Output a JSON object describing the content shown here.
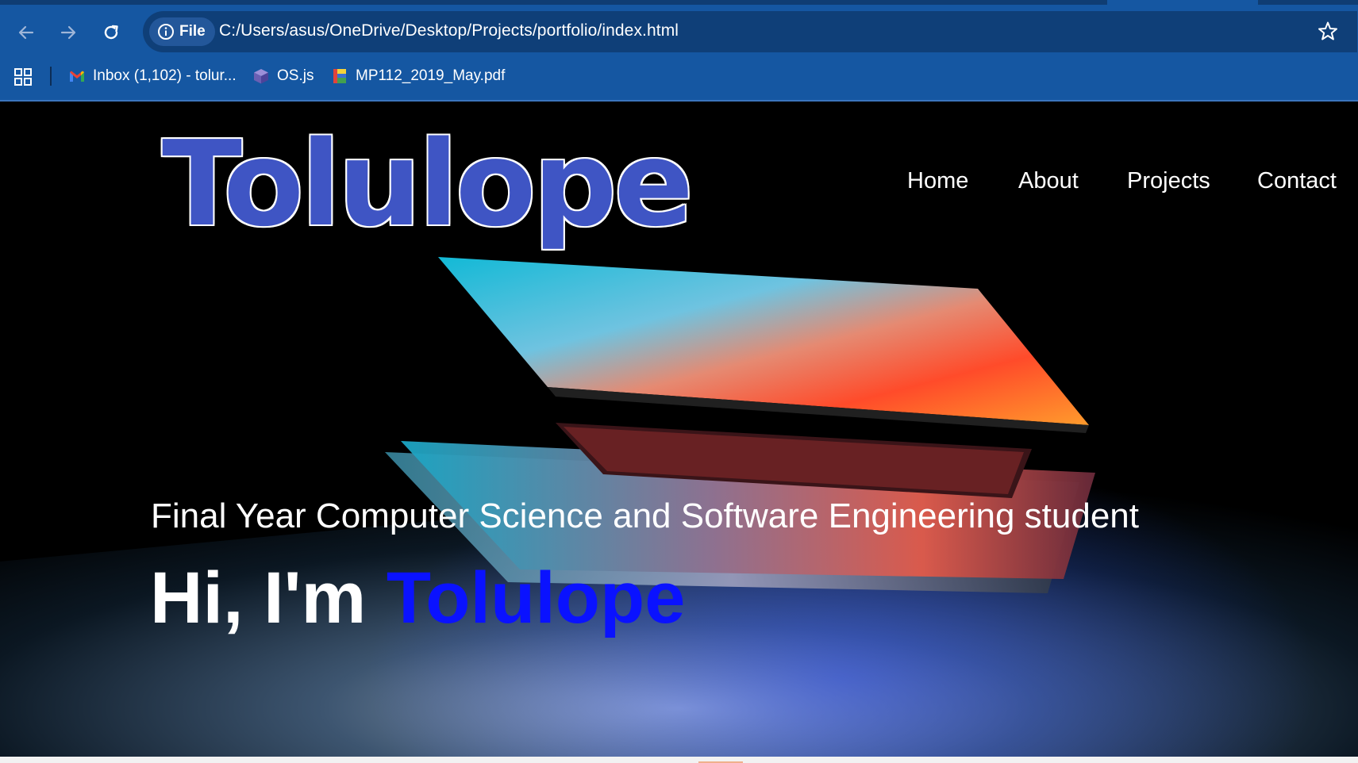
{
  "browser": {
    "site_chip_label": "File",
    "url": "C:/Users/asus/OneDrive/Desktop/Projects/portfolio/index.html",
    "bookmarks": [
      {
        "label": "Inbox (1,102) - tolur...",
        "icon": "gmail-icon"
      },
      {
        "label": "OS.js",
        "icon": "cube-icon"
      },
      {
        "label": "MP112_2019_May.pdf",
        "icon": "pdf-file-icon"
      }
    ],
    "icons": {
      "back": "back-arrow-icon",
      "forward": "forward-arrow-icon",
      "reload": "reload-icon",
      "info": "info-icon",
      "star": "star-icon",
      "apps": "apps-grid-icon"
    },
    "colors": {
      "toolbar": "#1557a2",
      "omnibox": "#0f3f78"
    }
  },
  "page": {
    "logo_text": "Tolulope",
    "nav": [
      "Home",
      "About",
      "Projects",
      "Contact"
    ],
    "subtitle": "Final Year Computer Science and Software Engineering student",
    "greeting_prefix": "Hi, I'm ",
    "greeting_name": "Tolulope",
    "colors": {
      "logo": "#3f55c4",
      "name_accent": "#0a12ff",
      "background": "#000000"
    }
  }
}
